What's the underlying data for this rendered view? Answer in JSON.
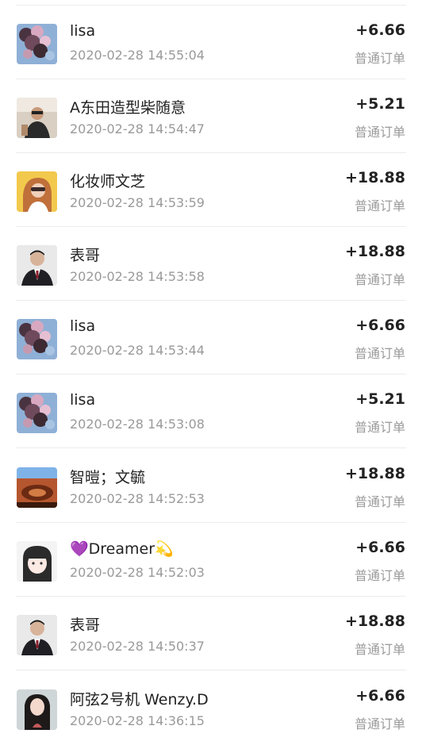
{
  "orders": [
    {
      "name": "lisa",
      "time": "2020-02-28 14:55:04",
      "amount": "+6.66",
      "type": "普通订单",
      "avatar": "flowers"
    },
    {
      "name": "A东田造型柴随意",
      "time": "2020-02-28 14:54:47",
      "amount": "+5.21",
      "type": "普通订单",
      "avatar": "man-sunglasses"
    },
    {
      "name": "化妆师文芝",
      "time": "2020-02-28 14:53:59",
      "amount": "+18.88",
      "type": "普通订单",
      "avatar": "woman-yellow"
    },
    {
      "name": "表哥",
      "time": "2020-02-28 14:53:58",
      "amount": "+18.88",
      "type": "普通订单",
      "avatar": "man-suit"
    },
    {
      "name": "lisa",
      "time": "2020-02-28 14:53:44",
      "amount": "+6.66",
      "type": "普通订单",
      "avatar": "flowers"
    },
    {
      "name": "lisa",
      "time": "2020-02-28 14:53:08",
      "amount": "+5.21",
      "type": "普通订单",
      "avatar": "flowers"
    },
    {
      "name": "智暟；文毓",
      "time": "2020-02-28 14:52:53",
      "amount": "+18.88",
      "type": "普通订单",
      "avatar": "canyon"
    },
    {
      "name": "💜Dreamer💫",
      "time": "2020-02-28 14:52:03",
      "amount": "+6.66",
      "type": "普通订单",
      "avatar": "anime-girl"
    },
    {
      "name": "表哥",
      "time": "2020-02-28 14:50:37",
      "amount": "+18.88",
      "type": "普通订单",
      "avatar": "man-suit"
    },
    {
      "name": "阿弦2号机 Wenzy.D",
      "time": "2020-02-28 14:36:15",
      "amount": "+6.66",
      "type": "普通订单",
      "avatar": "woman-portrait"
    }
  ]
}
